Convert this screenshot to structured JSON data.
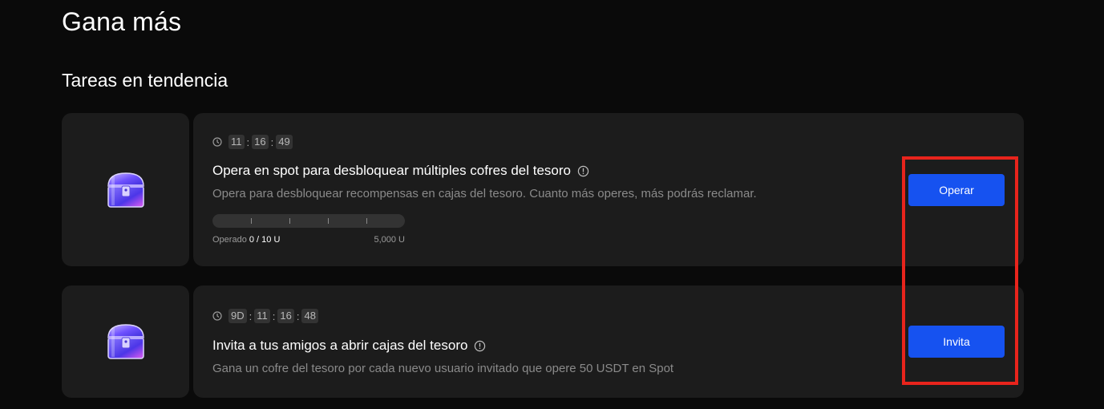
{
  "page": {
    "title": "Gana más",
    "section_title": "Tareas en tendencia"
  },
  "tasks": [
    {
      "icon": "treasure-chest-icon",
      "timer": [
        "11",
        "16",
        "49"
      ],
      "title": "Opera en spot para desbloquear múltiples cofres del tesoro",
      "description": "Opera para desbloquear recompensas en cajas del tesoro. Cuanto más operes, más podrás reclamar.",
      "progress": {
        "label": "Operado",
        "current": "0 / 10 U",
        "max_label": "5,000 U",
        "fraction": 0
      },
      "button_label": "Operar"
    },
    {
      "icon": "treasure-chest-icon",
      "timer": [
        "9D",
        "11",
        "16",
        "48"
      ],
      "title": "Invita a tus amigos a abrir cajas del tesoro",
      "description": "Gana un cofre del tesoro por cada nuevo usuario invitado que opere 50 USDT en Spot",
      "button_label": "Invita"
    }
  ],
  "colors": {
    "background": "#0a0a0a",
    "card": "#1c1c1c",
    "accent": "#1652f0",
    "highlight": "#e8241c"
  }
}
